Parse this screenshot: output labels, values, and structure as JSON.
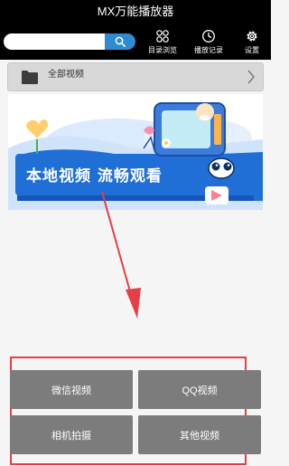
{
  "app": {
    "title": "MX万能播放器"
  },
  "search": {
    "placeholder": "",
    "button_icon": "search-icon"
  },
  "toolbar": {
    "items": [
      {
        "label": "目录浏览",
        "icon": "directory-icon"
      },
      {
        "label": "播放记录",
        "icon": "history-clock-icon"
      },
      {
        "label": "设置",
        "icon": "gear-icon"
      }
    ]
  },
  "folder": {
    "label": "全部视频",
    "icon": "folder-icon",
    "chevron": "chevron-right-icon"
  },
  "banner": {
    "headline": "本地视频 流畅观看"
  },
  "categories": [
    {
      "label": "微信视频"
    },
    {
      "label": "QQ视频"
    },
    {
      "label": "相机拍摄"
    },
    {
      "label": "其他视频"
    }
  ],
  "colors": {
    "accent": "#2e8bd1",
    "highlight": "#e63e44",
    "button_bg": "#7c7c7c",
    "banner_blue": "#1f6fd6"
  }
}
